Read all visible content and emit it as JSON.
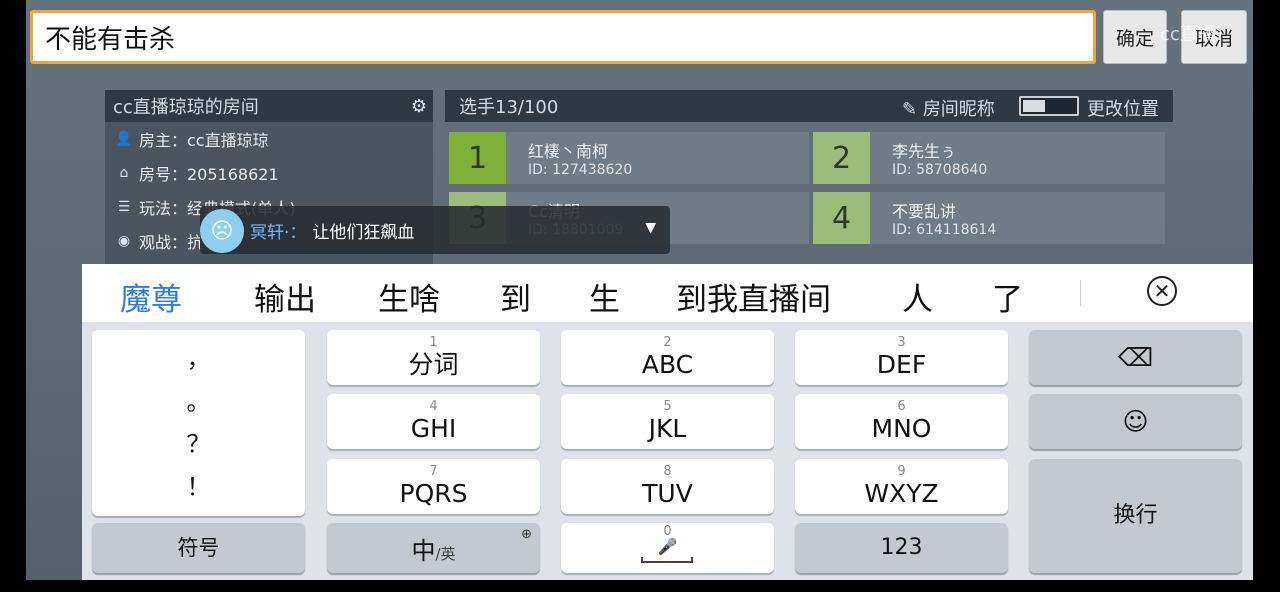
{
  "input": {
    "value": "不能有击杀"
  },
  "top_buttons": {
    "confirm": "确定",
    "cancel": "取消"
  },
  "watermark": "cc直播",
  "room": {
    "title": "cc直播琼琼的房间",
    "owner": "房主：cc直播琼琼",
    "number": "房号：205168621",
    "mode": "玩法：经典模式(单人)",
    "spectate": "观战：抗"
  },
  "players_header": {
    "count": "选手13/100",
    "nickname_label": "房间昵称",
    "move_label": "更改位置"
  },
  "players": [
    {
      "num": "1",
      "name": "红棲丶南柯",
      "id": "ID: 127438620"
    },
    {
      "num": "2",
      "name": "李先生ぅ",
      "id": "ID: 58708640"
    },
    {
      "num": "3",
      "name": "Cc清明",
      "id": "ID: 18801009"
    },
    {
      "num": "4",
      "name": "不要乱讲",
      "id": "ID: 614118614"
    }
  ],
  "chat": {
    "user": "冥轩·：",
    "message": "让他们狂飙血"
  },
  "keyboard": {
    "candidates": [
      "魔尊",
      "输出",
      "生啥",
      "到",
      "生",
      "到我直播间",
      "人",
      "了"
    ],
    "punctuation": [
      "，",
      "。",
      "？",
      "！"
    ],
    "keys": [
      {
        "sub": "1",
        "main": "分词"
      },
      {
        "sub": "2",
        "main": "ABC"
      },
      {
        "sub": "3",
        "main": "DEF"
      },
      {
        "sub": "4",
        "main": "GHI"
      },
      {
        "sub": "5",
        "main": "JKL"
      },
      {
        "sub": "6",
        "main": "MNO"
      },
      {
        "sub": "7",
        "main": "PQRS"
      },
      {
        "sub": "8",
        "main": "TUV"
      },
      {
        "sub": "9",
        "main": "WXYZ"
      }
    ],
    "symbol": "符号",
    "lang_main": "中",
    "lang_sub": "/英",
    "space_sub": "0",
    "num": "123",
    "newline": "换行"
  },
  "colors": {
    "accent_blue": "#2d7be6",
    "input_border": "#f0a640",
    "green_slot": "#7fb03a"
  }
}
